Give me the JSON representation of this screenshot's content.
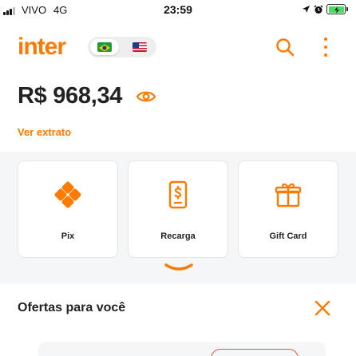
{
  "status_bar": {
    "carrier": "VIVO",
    "network": "4G",
    "time": "23:59",
    "icons": [
      "signal-bars-icon",
      "location-arrow-icon",
      "alarm-icon",
      "battery-charging-icon"
    ]
  },
  "header": {
    "logo": "inter",
    "flags": [
      "brazil-flag-icon",
      "usa-flag-icon"
    ],
    "active_flag": "brazil",
    "icons": [
      "search-icon",
      "more-vertical-icon"
    ]
  },
  "balance": {
    "amount": "R$ 968,34",
    "icon": "eye-icon"
  },
  "statement_link": "Ver extrato",
  "shortcuts": [
    {
      "label": "Pix",
      "icon": "pix-icon"
    },
    {
      "label": "Recarga",
      "icon": "phone-recharge-icon"
    },
    {
      "label": "Gift Card",
      "icon": "gift-icon"
    }
  ],
  "expand_icon": "chevron-down-icon",
  "offers": {
    "title": "Ofertas para você",
    "close_icon": "close-icon"
  },
  "colors": {
    "brand_orange": "#ff7a00",
    "background_gray": "#f5f6f8",
    "text_dark": "#222222"
  }
}
